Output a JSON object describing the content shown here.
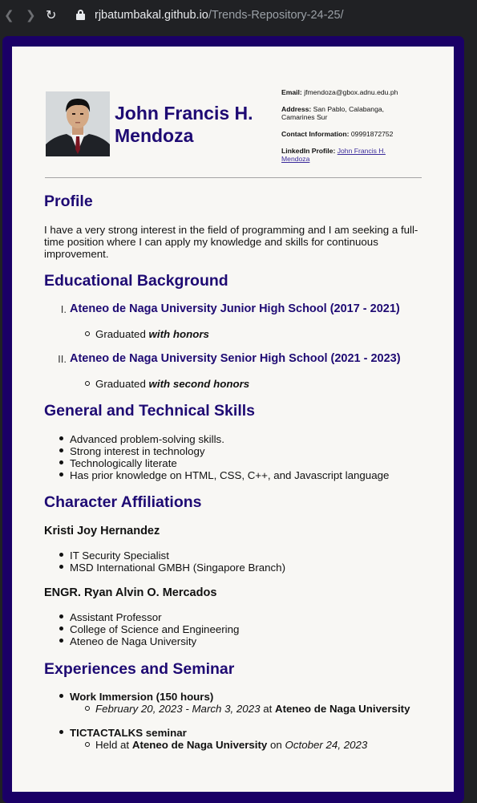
{
  "browser": {
    "url_host": "rjbatumbakal.github.io",
    "url_path": "/Trends-Repository-24-25/"
  },
  "header": {
    "name_line1": "John Francis H.",
    "name_line2": "Mendoza",
    "photo_alt": "Profile photo",
    "contact": {
      "email_label": "Email:",
      "email_value": "jfmendoza@gbox.adnu.edu.ph",
      "address_label": "Address:",
      "address_line1": "San Pablo, Calabanga,",
      "address_line2": "Camarines Sur",
      "phone_label": "Contact Information:",
      "phone_value": "09991872752",
      "linkedin_label": "LinkedIn Profile:",
      "linkedin_line1": "John Francis H.",
      "linkedin_line2": "Mendoza"
    }
  },
  "profile": {
    "heading": "Profile",
    "line1": "I have a very strong interest in the field of programming and I am seeking a full-",
    "line2": "time position where I can apply my knowledge and skills for continuous",
    "line3": "improvement."
  },
  "education": {
    "heading": "Educational Background",
    "items": [
      {
        "numeral": "I.",
        "school": "Ateneo de Naga University Junior High School (2017 - 2021)",
        "note_prefix": "Graduated",
        "note_em": "with honors"
      },
      {
        "numeral": "II.",
        "school": "Ateneo de Naga University Senior High School (2021 - 2023)",
        "note_prefix": "Graduated",
        "note_em": "with second honors"
      }
    ]
  },
  "skills": {
    "heading": "General and Technical Skills",
    "items": [
      "Advanced problem-solving skills.",
      "Strong interest in technology",
      "Technologically literate",
      "Has prior knowledge on HTML, CSS, C++, and Javascript language"
    ]
  },
  "affiliations": {
    "heading": "Character Affiliations",
    "people": [
      {
        "name": "Kristi Joy Hernandez",
        "details": [
          "IT Security Specialist",
          "MSD International GMBH (Singapore Branch)"
        ]
      },
      {
        "name": "ENGR. Ryan Alvin O. Mercados",
        "details": [
          "Assistant Professor",
          "College of Science and Engineering",
          "Ateneo de Naga University"
        ]
      }
    ]
  },
  "experiences": {
    "heading": "Experiences and Seminar",
    "items": [
      {
        "title": "Work Immersion (150 hours)",
        "date": "February 20, 2023 - March 3, 2023",
        "connector": "at",
        "place": "Ateneo de Naga University"
      },
      {
        "title": "TICTACTALKS seminar",
        "lead": "Held at",
        "place": "Ateneo de Naga University",
        "connector": "on",
        "date": "October 24, 2023"
      }
    ]
  }
}
